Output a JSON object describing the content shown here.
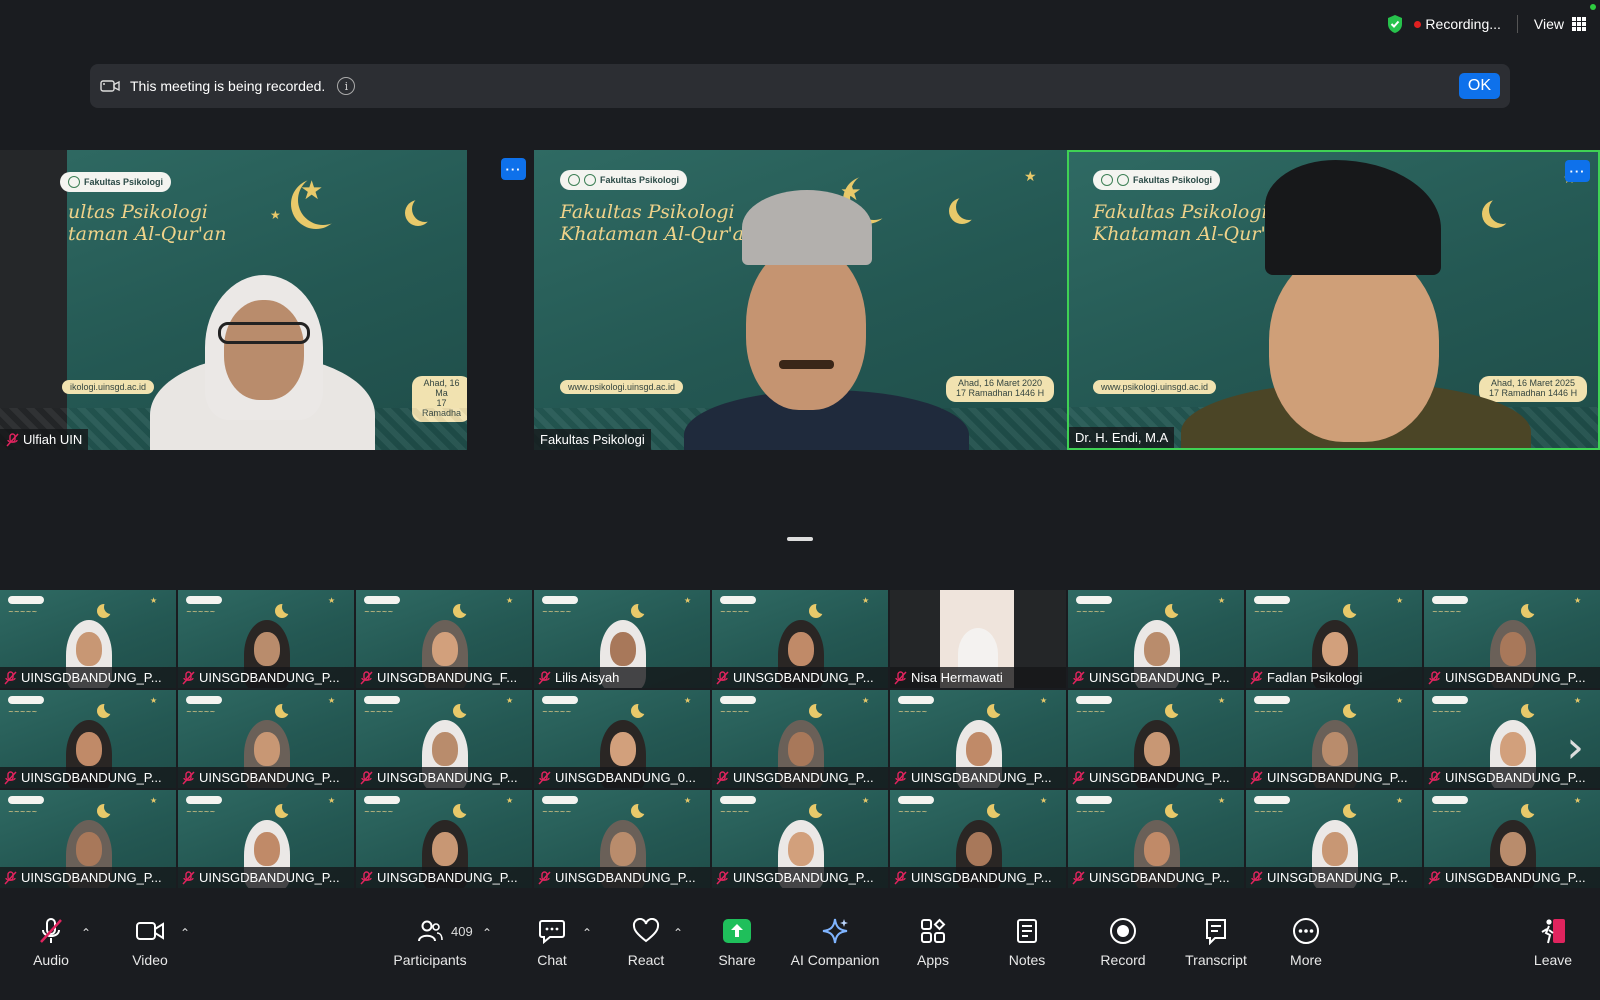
{
  "top": {
    "recording_label": "Recording...",
    "view_label": "View"
  },
  "banner": {
    "message": "This meeting is being recorded.",
    "ok_label": "OK"
  },
  "main_tiles": [
    {
      "name": "Ulfiah UIN",
      "muted": true,
      "slide_title_line1": "ultas Psikologi",
      "slide_title_line2": "taman Al-Qur'an",
      "logo": "Fakultas Psikologi",
      "url": "ikologi.uinsgd.ac.id",
      "date1": "Ahad, 16 Ma",
      "date2": "17 Ramadha"
    },
    {
      "name": "Fakultas Psikologi",
      "muted": false,
      "slide_title_line1": "Fakultas Psikologi",
      "slide_title_line2": "Khataman Al-Qur'an",
      "logo": "Fakultas Psikologi",
      "url": "www.psikologi.uinsgd.ac.id",
      "date1": "Ahad, 16 Maret 2020",
      "date2": "17 Ramadhan 1446 H"
    },
    {
      "name": "Dr. H. Endi, M.A",
      "muted": false,
      "slide_title_line1": "Fakultas Psikologi",
      "slide_title_line2": "Khataman Al-Qur'an",
      "logo": "Fakultas Psikologi",
      "url": "www.psikologi.uinsgd.ac.id",
      "date1": "Ahad, 16 Maret 2025",
      "date2": "17 Ramadhan 1446 H"
    }
  ],
  "more_badge": "···",
  "gallery": [
    [
      "UINSGDBANDUNG_P...",
      "UINSGDBANDUNG_P...",
      "UINSGDBANDUNG_F...",
      "Lilis Aisyah",
      "UINSGDBANDUNG_P...",
      "Nisa Hermawati",
      "UINSGDBANDUNG_P...",
      "Fadlan Psikologi",
      "UINSGDBANDUNG_P..."
    ],
    [
      "UINSGDBANDUNG_P...",
      "UINSGDBANDUNG_P...",
      "UINSGDBANDUNG_P...",
      "UINSGDBANDUNG_0...",
      "UINSGDBANDUNG_P...",
      "UINSGDBANDUNG_P...",
      "UINSGDBANDUNG_P...",
      "UINSGDBANDUNG_P...",
      "UINSGDBANDUNG_P..."
    ],
    [
      "UINSGDBANDUNG_P...",
      "UINSGDBANDUNG_P...",
      "UINSGDBANDUNG_P...",
      "UINSGDBANDUNG_P...",
      "UINSGDBANDUNG_P...",
      "UINSGDBANDUNG_P...",
      "UINSGDBANDUNG_P...",
      "UINSGDBANDUNG_P...",
      "UINSGDBANDUNG_P..."
    ]
  ],
  "toolbar": {
    "audio": "Audio",
    "video": "Video",
    "participants": "Participants",
    "participants_count": "409",
    "chat": "Chat",
    "react": "React",
    "share": "Share",
    "ai": "AI Companion",
    "apps": "Apps",
    "notes": "Notes",
    "record": "Record",
    "transcript": "Transcript",
    "more": "More",
    "leave": "Leave"
  },
  "colors": {
    "accent": "#0e71eb",
    "active_speaker": "#3fd254",
    "share_green": "#1fbf5b",
    "leave_red": "#e0245e"
  },
  "icons": [
    "shield-check-icon",
    "grid-icon",
    "camera-icon",
    "info-icon",
    "mic-off-icon",
    "video-camera-icon",
    "participants-icon",
    "chat-icon",
    "heart-icon",
    "share-arrow-icon",
    "sparkle-icon",
    "apps-icon",
    "notes-icon",
    "record-icon",
    "transcript-icon",
    "more-icon",
    "leave-icon",
    "chevron-right-icon"
  ]
}
